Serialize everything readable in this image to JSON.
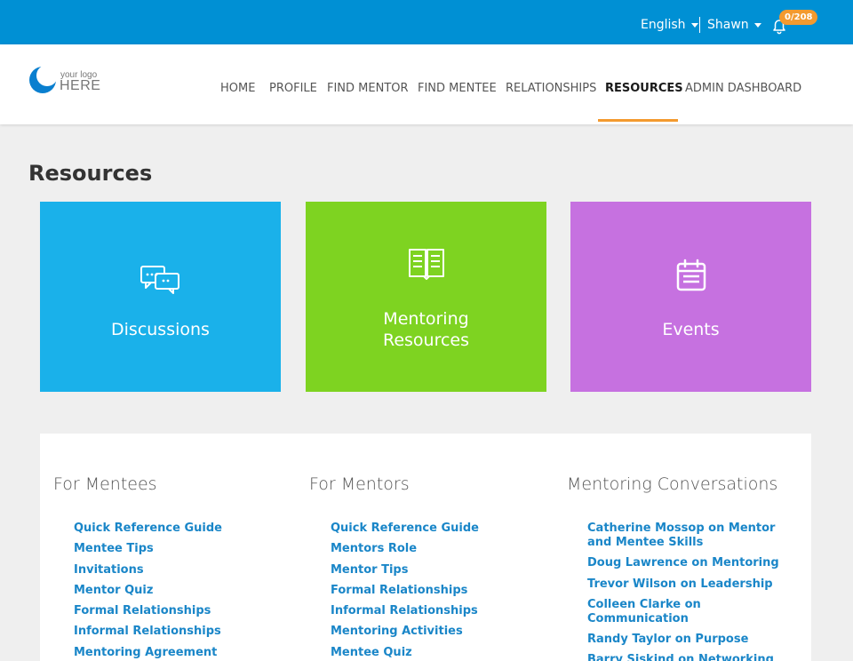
{
  "topbar": {
    "language": "English",
    "user": "Shawn",
    "notification_count": "0/208"
  },
  "logo": {
    "small_text": "your logo",
    "big_text": "HERE"
  },
  "nav": {
    "items": [
      "HOME",
      "PROFILE",
      "FIND MENTOR",
      "FIND MENTEE",
      "RELATIONSHIPS",
      "RESOURCES",
      "ADMIN DASHBOARD"
    ],
    "active": "RESOURCES"
  },
  "page": {
    "title": "Resources"
  },
  "tiles": [
    {
      "label": "Discussions",
      "icon": "chat-bubbles-icon",
      "color": "#1ab1ea"
    },
    {
      "label": "Mentoring Resources",
      "icon": "open-book-icon",
      "color": "#7ed321"
    },
    {
      "label": "Events",
      "icon": "calendar-icon",
      "color": "#c671e0"
    }
  ],
  "columns": [
    {
      "title": "For Mentees",
      "links": [
        "Quick Reference Guide",
        "Mentee Tips",
        "Invitations",
        "Mentor Quiz",
        "Formal Relationships",
        "Informal Relationships",
        "Mentoring Agreement"
      ]
    },
    {
      "title": "For Mentors",
      "links": [
        "Quick Reference Guide",
        "Mentors Role",
        "Mentor Tips",
        "Formal Relationships",
        "Informal Relationships",
        "Mentoring Activities",
        "Mentee Quiz"
      ]
    },
    {
      "title": "Mentoring Conversations",
      "links": [
        "Catherine Mossop on Mentor and Mentee Skills",
        "Doug Lawrence on Mentoring",
        "Trevor Wilson on Leadership",
        "Colleen Clarke on Communication",
        "Randy Taylor on Purpose",
        "Barry Siskind on Networking"
      ]
    }
  ],
  "colors": {
    "topbar": "#0090d4",
    "accent": "#f39a2f",
    "link": "#1a86c8"
  }
}
